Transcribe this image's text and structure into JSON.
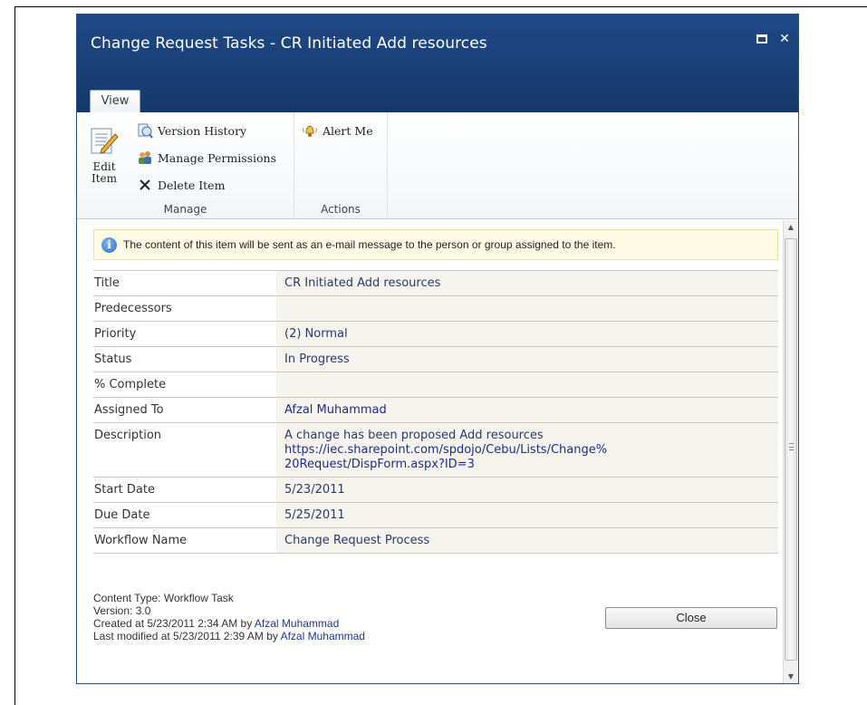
{
  "dialog": {
    "title": "Change Request Tasks - CR Initiated Add resources",
    "maximize_icon": "maximize-icon",
    "close_icon": "close-icon"
  },
  "ribbon": {
    "tab": "View",
    "manage": {
      "edit_item": "Edit Item",
      "version_history": "Version History",
      "manage_permissions": "Manage Permissions",
      "delete_item": "Delete Item",
      "label": "Manage"
    },
    "actions": {
      "alert_me": "Alert Me",
      "label": "Actions"
    }
  },
  "notice": "The content of this item will be sent as an e-mail message to the person or group assigned to the item.",
  "fields": [
    {
      "label": "Title",
      "value": "CR Initiated Add resources"
    },
    {
      "label": "Predecessors",
      "value": ""
    },
    {
      "label": "Priority",
      "value": "(2) Normal"
    },
    {
      "label": "Status",
      "value": "In Progress"
    },
    {
      "label": "% Complete",
      "value": ""
    },
    {
      "label": "Assigned To",
      "value": "Afzal Muhammad"
    },
    {
      "label": "Description",
      "value": "A change has been proposed Add resources",
      "link": "https://iec.sharepoint.com/spdojo/Cebu/Lists/Change%20Request/DispForm.aspx?ID=3",
      "link_line1": "https://iec.sharepoint.com/spdojo/Cebu/Lists/Change%",
      "link_line2": "20Request/DispForm.aspx?ID=3"
    },
    {
      "label": "Start Date",
      "value": "5/23/2011"
    },
    {
      "label": "Due Date",
      "value": "5/25/2011"
    },
    {
      "label": "Workflow Name",
      "value": "Change Request Process"
    }
  ],
  "meta": {
    "content_type": "Content Type: Workflow Task",
    "version": "Version: 3.0",
    "created_prefix": "Created at 5/23/2011 2:34 AM by ",
    "created_by": "Afzal Muhammad",
    "modified_prefix": "Last modified at 5/23/2011 2:39 AM by ",
    "modified_by": "Afzal Muhammad"
  },
  "close_button": "Close"
}
